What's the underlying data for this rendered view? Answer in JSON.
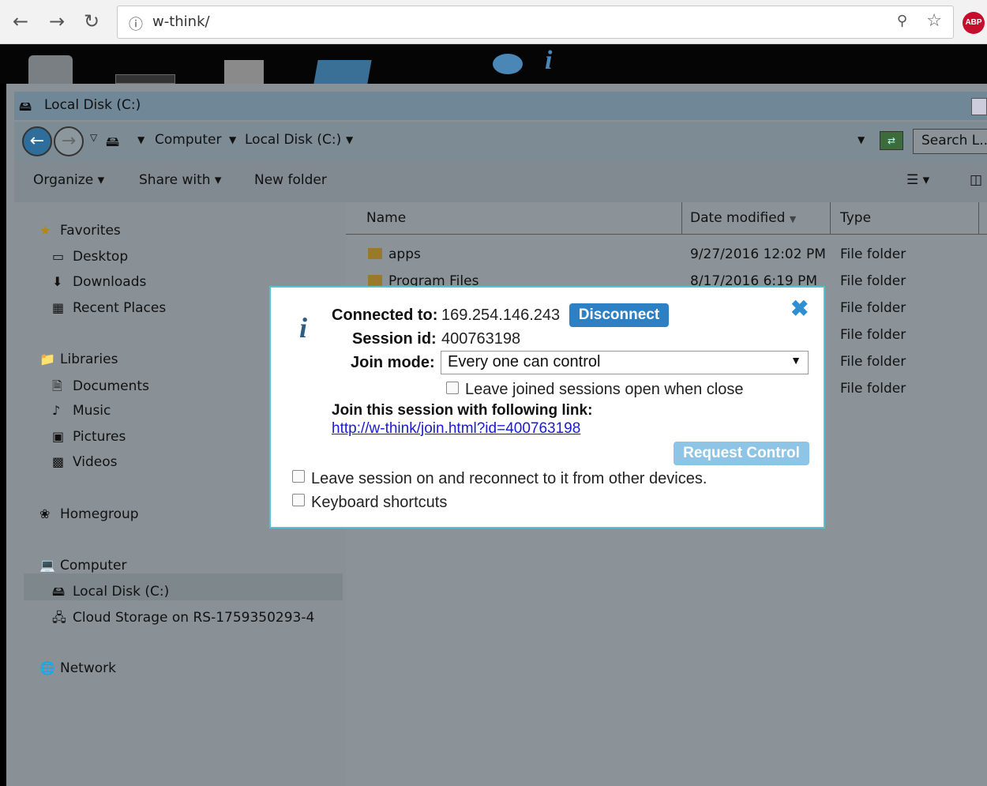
{
  "browser": {
    "url": "w-think/",
    "abp_label": "ABP"
  },
  "explorer": {
    "title": "Local Disk (C:)",
    "breadcrumb": [
      "Computer",
      "Local Disk (C:)"
    ],
    "search_placeholder": "Search L...",
    "toolbar": {
      "organize": "Organize",
      "share_with": "Share with",
      "new_folder": "New folder"
    },
    "nav": {
      "favorites": "Favorites",
      "desktop": "Desktop",
      "downloads": "Downloads",
      "recent_places": "Recent Places",
      "libraries": "Libraries",
      "documents": "Documents",
      "music": "Music",
      "pictures": "Pictures",
      "videos": "Videos",
      "homegroup": "Homegroup",
      "computer": "Computer",
      "local_disk": "Local Disk (C:)",
      "cloud_storage": "Cloud Storage on RS-1759350293-4",
      "network": "Network"
    },
    "columns": {
      "name": "Name",
      "date_modified": "Date modified",
      "type": "Type"
    },
    "files": [
      {
        "name": "apps",
        "date": "9/27/2016 12:02 PM",
        "type": "File folder"
      },
      {
        "name": "Program Files",
        "date": "8/17/2016 6:19 PM",
        "type": "File folder"
      },
      {
        "name": "",
        "date": "",
        "type": "File folder"
      },
      {
        "name": "",
        "date": "",
        "type": "File folder"
      },
      {
        "name": "",
        "date": "",
        "type": "File folder"
      },
      {
        "name": "",
        "date": "",
        "type": "File folder"
      }
    ]
  },
  "dialog": {
    "connected_label": "Connected to:",
    "connected_value": "169.254.146.243",
    "disconnect": "Disconnect",
    "session_label": "Session id:",
    "session_value": "400763198",
    "join_mode_label": "Join mode:",
    "join_mode_value": "Every one can control",
    "leave_joined": "Leave joined sessions open when close",
    "join_link_label": "Join this session with following link:",
    "join_link": "http://w-think/join.html?id=400763198",
    "request_control": "Request Control",
    "leave_session_on": "Leave session on and reconnect to it from other devices.",
    "keyboard_shortcuts": "Keyboard shortcuts"
  }
}
